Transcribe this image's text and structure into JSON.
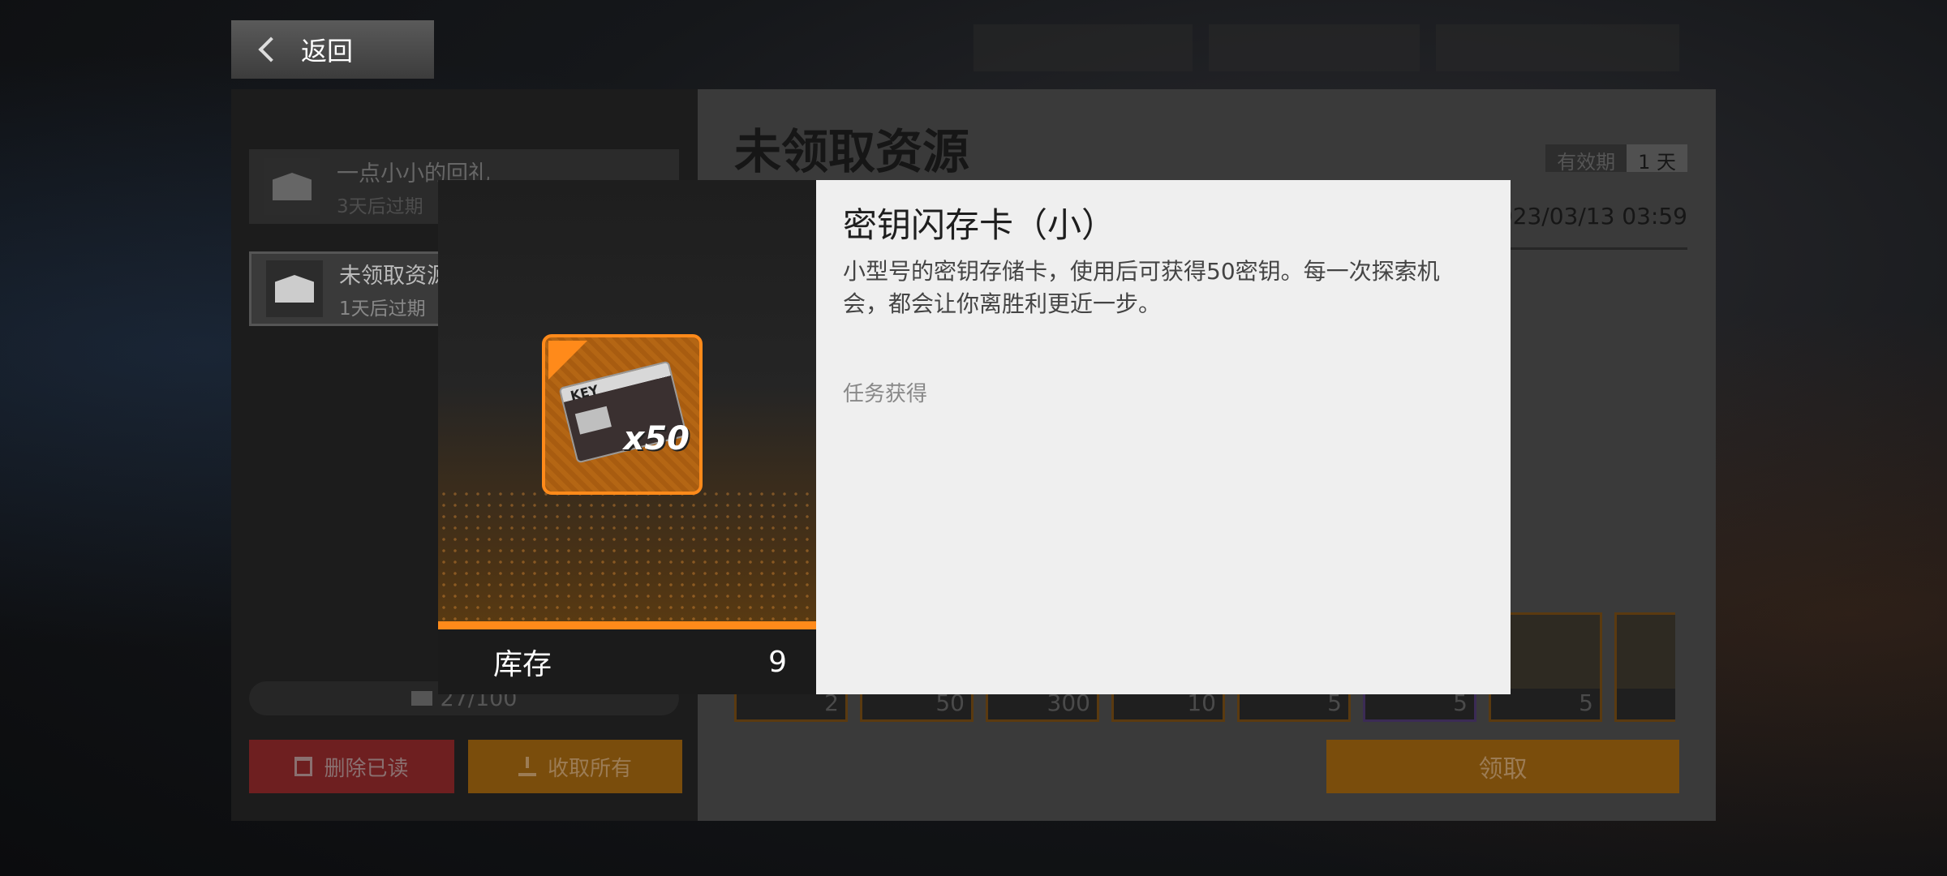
{
  "top": {
    "back_label": "返回"
  },
  "mail_list": {
    "items": [
      {
        "title": "一点小小的回礼",
        "expiry": "3天后过期"
      },
      {
        "title": "未领取资源",
        "expiry": "1天后过期"
      }
    ],
    "count": "27/100",
    "delete_read_label": "删除已读",
    "collect_all_label": "收取所有"
  },
  "mail_detail": {
    "title": "未领取资源",
    "validity_label": "有效期",
    "validity_value": "1 天",
    "date": "2023/03/13 03:59",
    "rewards": [
      {
        "qty": "2"
      },
      {
        "qty": "50"
      },
      {
        "qty": "300"
      },
      {
        "qty": "10"
      },
      {
        "qty": "5"
      },
      {
        "qty": "5"
      },
      {
        "qty": "5"
      },
      {
        "qty": ""
      }
    ],
    "claim_label": "领取"
  },
  "popup": {
    "title": "密钥闪存卡（小）",
    "description": "小型号的密钥存储卡，使用后可获得50密钥。每一次探索机会，都会让你离胜利更近一步。",
    "source": "任务获得",
    "stock_label": "库存",
    "stock_value": "9",
    "icon_text_key": "KEY",
    "icon_text_qty": "x50"
  },
  "colors": {
    "accent": "#ff8a1a",
    "popup_bg": "#efefef",
    "stock_bg": "#1b1b1b"
  }
}
